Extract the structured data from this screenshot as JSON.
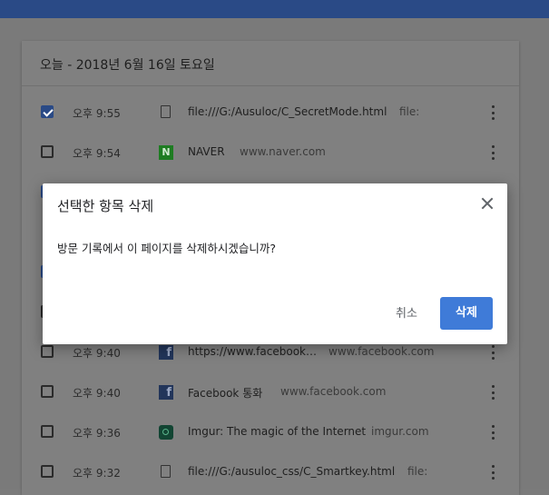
{
  "card": {
    "date_header": "오늘 - 2018년 6월 16일 토요일"
  },
  "rows": [
    {
      "checked": true,
      "time": "오후 9:55",
      "icon": "file-icon",
      "title": "file:///G:/Ausuloc/C_SecretMode.html",
      "domain": "file:"
    },
    {
      "checked": false,
      "time": "오후 9:54",
      "icon": "naver-icon",
      "title": "NAVER",
      "domain": "www.naver.com"
    },
    {
      "checked": false,
      "time": "오후 9:40",
      "icon": "facebook-icon",
      "title": "https://www.facebook…",
      "domain": "www.facebook.com"
    },
    {
      "checked": false,
      "time": "오후 9:40",
      "icon": "facebook-icon",
      "title": "Facebook 통화",
      "domain": "www.facebook.com"
    },
    {
      "checked": false,
      "time": "오후 9:36",
      "icon": "imgur-icon",
      "title": "Imgur: The magic of the Internet",
      "domain": "imgur.com"
    },
    {
      "checked": false,
      "time": "오후 9:32",
      "icon": "file-icon",
      "title": "file:///G:/ausuloc_css/C_Smartkey.html",
      "domain": "file:"
    }
  ],
  "dialog": {
    "title": "선택한 항목 삭제",
    "message": "방문 기록에서 이 페이지를 삭제하시겠습니까?",
    "cancel_label": "취소",
    "delete_label": "삭제"
  },
  "icons": {
    "naver_letter": "N",
    "facebook_letter": "f"
  },
  "colors": {
    "topbar": "#2a4a86",
    "checkbox_checked": "#2a4a86",
    "delete_button": "#3f7bd8"
  }
}
